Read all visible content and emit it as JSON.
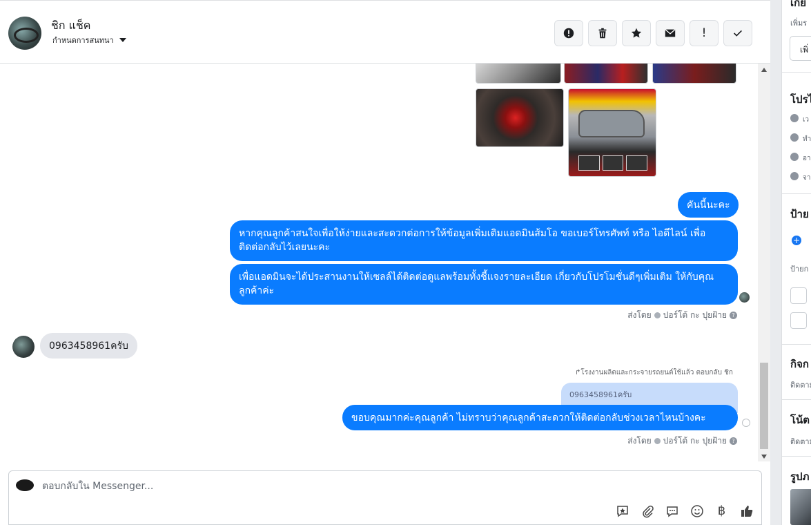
{
  "header": {
    "contact_name": "ชิก แช็ค",
    "conversation_label": "กำหนดการสนทนา",
    "actions": [
      {
        "name": "report",
        "label": "!"
      },
      {
        "name": "delete",
        "label": "🗑"
      },
      {
        "name": "star",
        "label": "★"
      },
      {
        "name": "mark-unread",
        "label": "✉"
      },
      {
        "name": "spam",
        "label": "!"
      },
      {
        "name": "done",
        "label": "✓"
      }
    ]
  },
  "thread": {
    "messages_out": [
      "คันนี้นะคะ",
      "หากคุณลูกค้าสนใจเพื่อให้ง่ายและสะดวกต่อการให้ข้อมูลเพิ่มเติมแอดมินส้มโอ ขอเบอร์โทรศัพท์ หรือ ไอดีไลน์ เพื่อติดต่อกลับไว้เลยนะคะ",
      "เพื่อแอดมินจะได้ประสานงานให้เซลล์ได้ติดต่อดูแลพร้อมทั้งชี้แจงรายละเอียด เกี่ยวกับโปรโมชั่นดีๆเพิ่มเติม ให้กับคุณลูกค้าค่ะ"
    ],
    "sent_by_1": "ส่งโดย",
    "sender_1": "ปอร์โต้ กะ ปุยฝ้าย",
    "incoming": "0963458961ครับ",
    "reply_note": "↱โรงงานผลิตและกระจายรถยนต์ใช้แล้ว ตอบกลับ ชิก",
    "quoted": "0963458961ครับ",
    "reply_message": "ขอบคุณมากค่ะคุณลูกค้า ไม่ทราบว่าคุณลูกค้าสะดวกให้ติดต่อกลับช่วงเวลาไหนบ้างคะ",
    "sent_by_2": "ส่งโดย",
    "sender_2": "ปอร์โต้ กะ ปุยฝ้าย"
  },
  "composer": {
    "placeholder": "ตอบกลับใน Messenger...",
    "tools": [
      "saved-reply-icon",
      "attach-icon",
      "chat-icon",
      "emoji-icon",
      "baht-icon",
      "like-icon"
    ],
    "baht_symbol": "฿"
  },
  "right_panel": {
    "section1_title": "เกี่ย",
    "section1_sub": "เพิ่มร",
    "section1_button": "เพิ่",
    "profile_title": "โปรไ",
    "profile_lines": [
      "เว",
      "ทำ",
      "อา",
      "จา"
    ],
    "labels_title": "ป้าย",
    "labels_sub": "ป้ายก",
    "activity_title": "กิจก",
    "activity_sub": "ติดตาม",
    "notes_title": "โน้ต",
    "notes_sub": "ติดตาม",
    "photos_title": "รูปภ"
  }
}
